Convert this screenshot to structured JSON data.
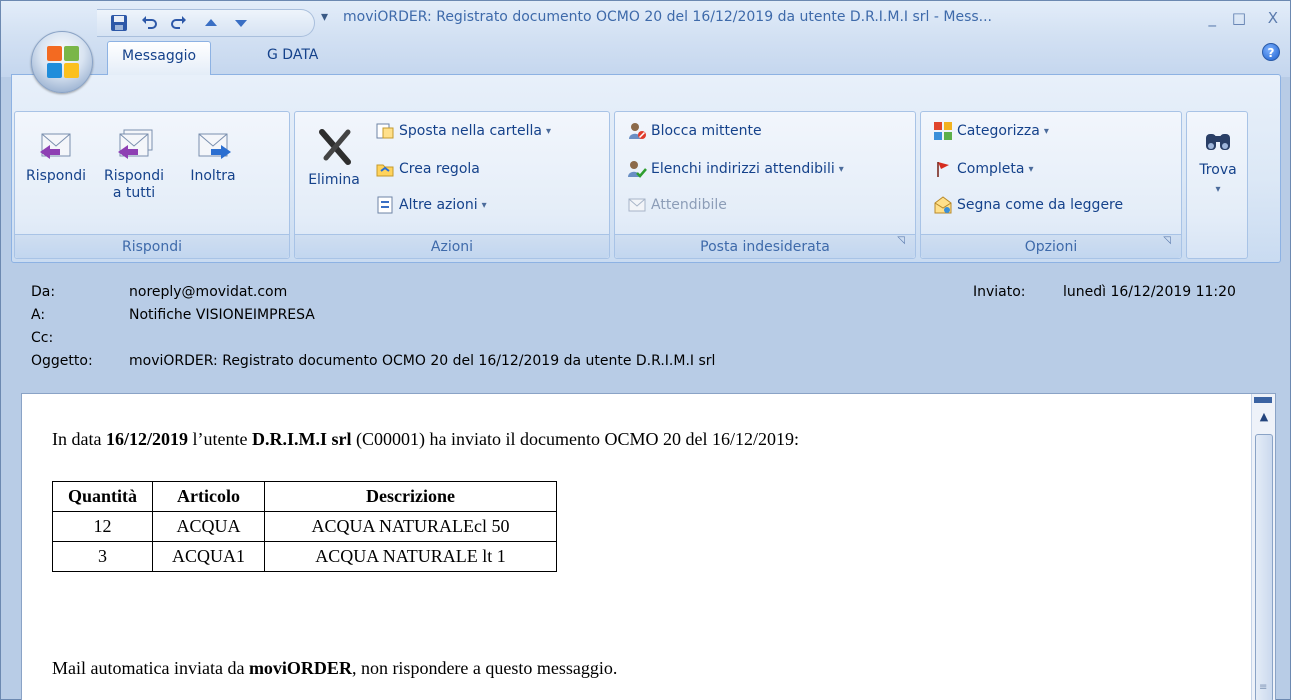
{
  "window": {
    "title": "moviORDER: Registrato documento OCMO 20 del 16/12/2019 da utente D.R.I.M.I srl - Mess...",
    "minimize": "_",
    "maximize": "□",
    "close": "X"
  },
  "qat": {
    "separator": "▾"
  },
  "tabs": [
    {
      "label": "Messaggio",
      "active": true
    },
    {
      "label": "G DATA",
      "active": false
    }
  ],
  "help": "?",
  "ribbon": {
    "rispondi": {
      "label": "Rispondi",
      "buttons": [
        {
          "label": "Rispondi"
        },
        {
          "label": "Rispondi a tutti"
        },
        {
          "label": "Inoltra"
        }
      ]
    },
    "azioni": {
      "label": "Azioni",
      "elimina": "Elimina",
      "sposta": "Sposta nella cartella",
      "crea_regola": "Crea regola",
      "altre_azioni": "Altre azioni",
      "dropdown": "▾"
    },
    "posta": {
      "label": "Posta indesiderata",
      "blocca": "Blocca mittente",
      "elenchi": "Elenchi indirizzi attendibili",
      "attendibile": "Attendibile"
    },
    "opzioni": {
      "label": "Opzioni",
      "categorizza": "Categorizza",
      "completa": "Completa",
      "segna": "Segna come da leggere"
    },
    "trova": {
      "label": "Trova"
    }
  },
  "header": {
    "da_label": "Da:",
    "da_value": "noreply@movidat.com",
    "a_label": "A:",
    "a_value": "Notifiche VISIONEIMPRESA",
    "cc_label": "Cc:",
    "cc_value": "",
    "oggetto_label": "Oggetto:",
    "oggetto_value": "moviORDER: Registrato documento OCMO 20 del 16/12/2019 da utente D.R.I.M.I srl",
    "inviato_label": "Inviato:",
    "inviato_value": "lunedì 16/12/2019 11:20"
  },
  "body": {
    "intro_pre": "In data ",
    "intro_date": "16/12/2019",
    "intro_mid": " l’utente ",
    "intro_user": "D.R.I.M.I srl",
    "intro_post": " (C00001) ha inviato il documento OCMO 20 del 16/12/2019:",
    "table": {
      "headers": [
        "Quantità",
        "Articolo",
        "Descrizione"
      ],
      "rows": [
        [
          "12",
          "ACQUA",
          "ACQUA NATURALEcl 50"
        ],
        [
          "3",
          "ACQUA1",
          "ACQUA NATURALE lt 1"
        ]
      ]
    },
    "footer_pre": "Mail automatica inviata da ",
    "footer_brand": "moviORDER",
    "footer_post": ", non rispondere a questo messaggio."
  }
}
